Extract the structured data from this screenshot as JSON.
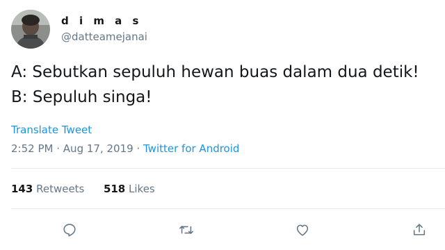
{
  "user": {
    "display_name": "d i m a s",
    "handle": "@datteamejanai"
  },
  "tweet": {
    "lines": [
      "A: Sebutkan sepuluh hewan buas dalam dua detik!",
      "B: Sepuluh singa!"
    ],
    "translate_label": "Translate Tweet",
    "time": "2:52 PM",
    "separator": "·",
    "date": "Aug 17, 2019",
    "source": "Twitter for Android"
  },
  "stats": {
    "retweets_count": "143",
    "retweets_label": "Retweets",
    "likes_count": "518",
    "likes_label": "Likes"
  },
  "actions": [
    {
      "icon": "reply-icon"
    },
    {
      "icon": "retweet-icon"
    },
    {
      "icon": "like-icon"
    },
    {
      "icon": "share-icon"
    }
  ],
  "colors": {
    "text": "#14171a",
    "secondary": "#657786",
    "link": "#1b95e0",
    "divider": "#e6ecf0"
  }
}
